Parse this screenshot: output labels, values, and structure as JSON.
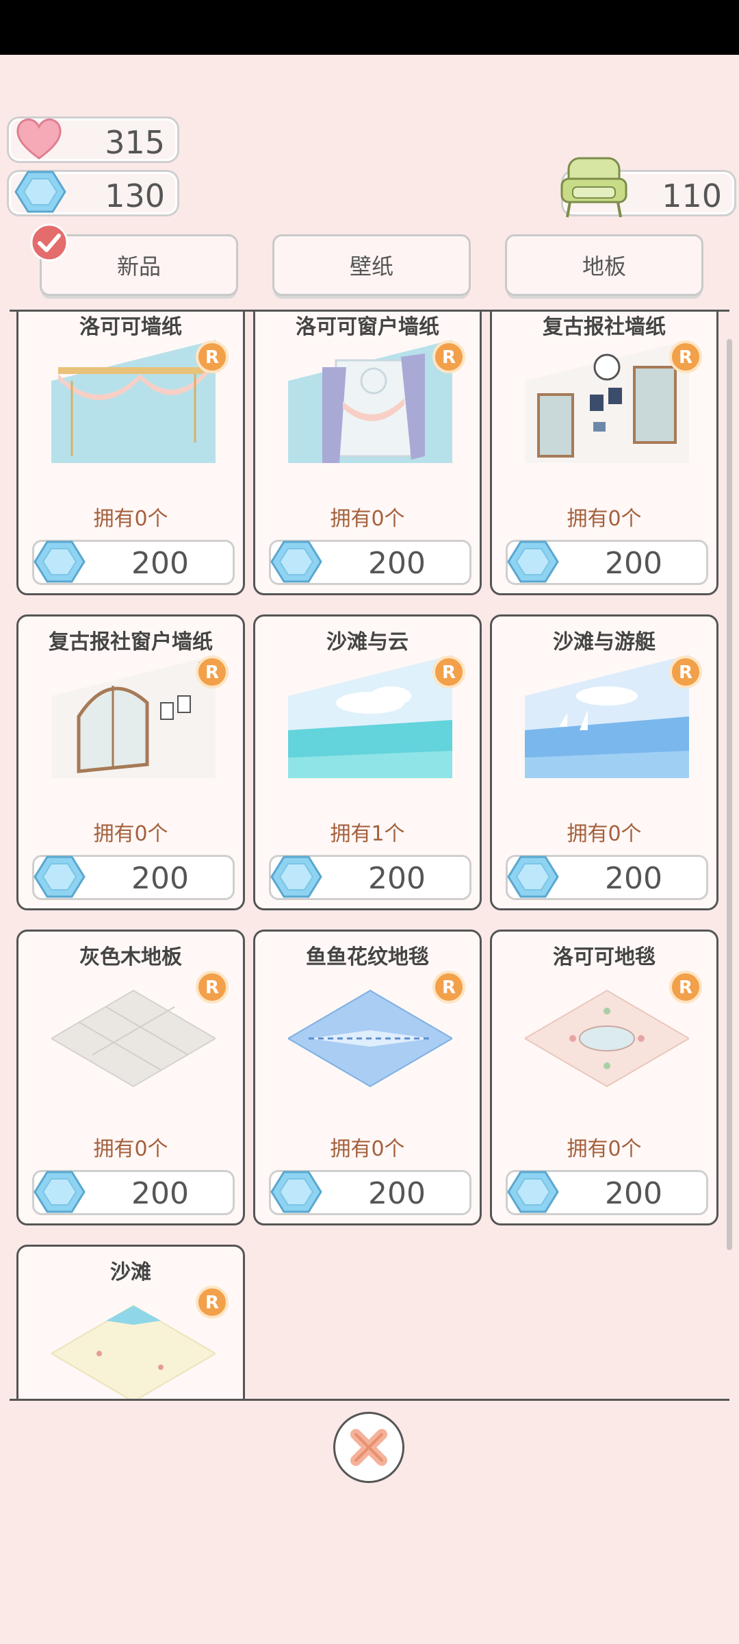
{
  "stats": {
    "hearts": "315",
    "gems": "130",
    "chairs": "110"
  },
  "tabs": [
    {
      "label": "新品",
      "selected": true
    },
    {
      "label": "壁纸"
    },
    {
      "label": "地板"
    }
  ],
  "items": [
    {
      "title": "洛可可墙纸",
      "owned": "拥有0个",
      "price": "200"
    },
    {
      "title": "洛可可窗户墙纸",
      "owned": "拥有0个",
      "price": "200"
    },
    {
      "title": "复古报社墙纸",
      "owned": "拥有0个",
      "price": "200"
    },
    {
      "title": "复古报社窗户墙纸",
      "owned": "拥有0个",
      "price": "200"
    },
    {
      "title": "沙滩与云",
      "owned": "拥有1个",
      "price": "200"
    },
    {
      "title": "沙滩与游艇",
      "owned": "拥有0个",
      "price": "200"
    },
    {
      "title": "灰色木地板",
      "owned": "拥有0个",
      "price": "200"
    },
    {
      "title": "鱼鱼花纹地毯",
      "owned": "拥有0个",
      "price": "200"
    },
    {
      "title": "洛可可地毯",
      "owned": "拥有0个",
      "price": "200"
    },
    {
      "title": "沙滩",
      "owned": "",
      "price": ""
    }
  ],
  "badge_letter": "R",
  "colors": {
    "background": "#fbe9e8",
    "owned_text": "#a4603d",
    "badge": "#f2a04a",
    "gem": "#8fd3f2"
  }
}
